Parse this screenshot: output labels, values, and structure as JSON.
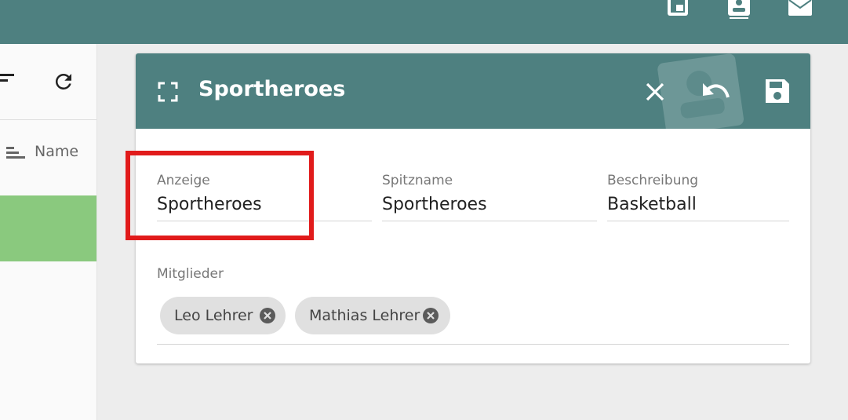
{
  "sidebar": {
    "column_header": "Name"
  },
  "dialog": {
    "title": "Sportheroes",
    "fields": {
      "anzeige": {
        "label": "Anzeige",
        "value": "Sportheroes"
      },
      "spitzname": {
        "label": "Spitzname",
        "value": "Sportheroes"
      },
      "beschreibung": {
        "label": "Beschreibung",
        "value": "Basketball"
      }
    },
    "members": {
      "label": "Mitglieder",
      "chips": [
        "Leo Lehrer",
        "Mathias Lehrer"
      ]
    }
  },
  "colors": {
    "header": "#4e8080",
    "highlight": "#e11b1b",
    "selected_row": "#8ac97e"
  },
  "icons": [
    "layout-icon",
    "contact-icon",
    "mail-icon",
    "filter-icon",
    "refresh-icon",
    "sort-icon",
    "expand-icon",
    "close-icon",
    "undo-icon",
    "save-icon",
    "chip-remove-icon"
  ]
}
